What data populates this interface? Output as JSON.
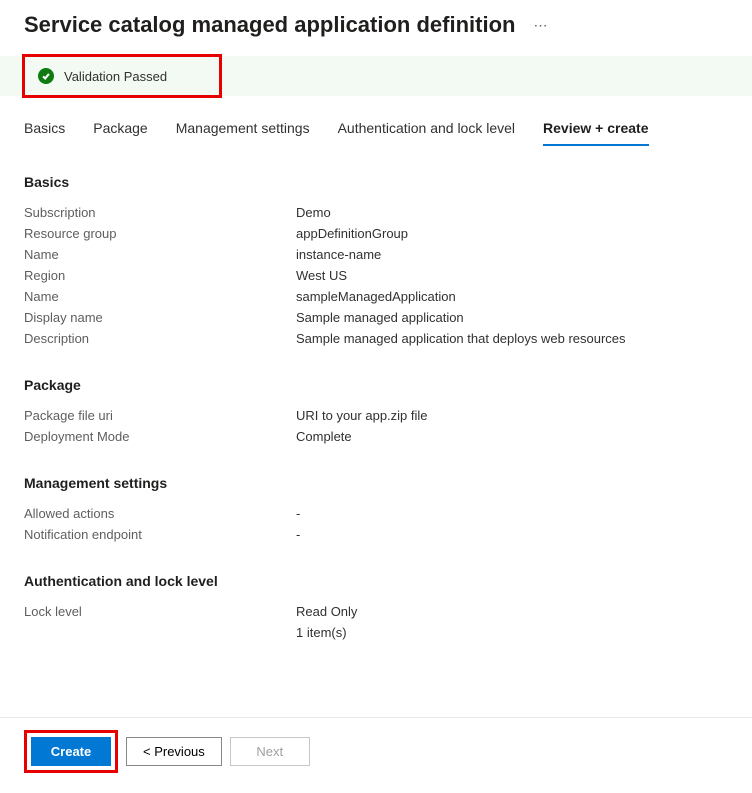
{
  "header": {
    "title": "Service catalog managed application definition"
  },
  "validation": {
    "message": "Validation Passed"
  },
  "tabs": [
    {
      "label": "Basics",
      "active": false
    },
    {
      "label": "Package",
      "active": false
    },
    {
      "label": "Management settings",
      "active": false
    },
    {
      "label": "Authentication and lock level",
      "active": false
    },
    {
      "label": "Review + create",
      "active": true
    }
  ],
  "sections": {
    "basics": {
      "heading": "Basics",
      "rows": [
        {
          "label": "Subscription",
          "value": "Demo"
        },
        {
          "label": "Resource group",
          "value": "appDefinitionGroup"
        },
        {
          "label": "Name",
          "value": "instance-name"
        },
        {
          "label": "Region",
          "value": "West US"
        },
        {
          "label": "Name",
          "value": "sampleManagedApplication"
        },
        {
          "label": "Display name",
          "value": "Sample managed application"
        },
        {
          "label": "Description",
          "value": "Sample managed application that deploys web resources"
        }
      ]
    },
    "package": {
      "heading": "Package",
      "rows": [
        {
          "label": "Package file uri",
          "value": "URI to your app.zip file"
        },
        {
          "label": "Deployment Mode",
          "value": "Complete"
        }
      ]
    },
    "management": {
      "heading": "Management settings",
      "rows": [
        {
          "label": "Allowed actions",
          "value": "-"
        },
        {
          "label": "Notification endpoint",
          "value": "-"
        }
      ]
    },
    "auth": {
      "heading": "Authentication and lock level",
      "rows": [
        {
          "label": "Lock level",
          "value": "Read Only"
        },
        {
          "label": "",
          "value": "1 item(s)"
        }
      ]
    }
  },
  "footer": {
    "create": "Create",
    "previous": "< Previous",
    "next": "Next"
  }
}
